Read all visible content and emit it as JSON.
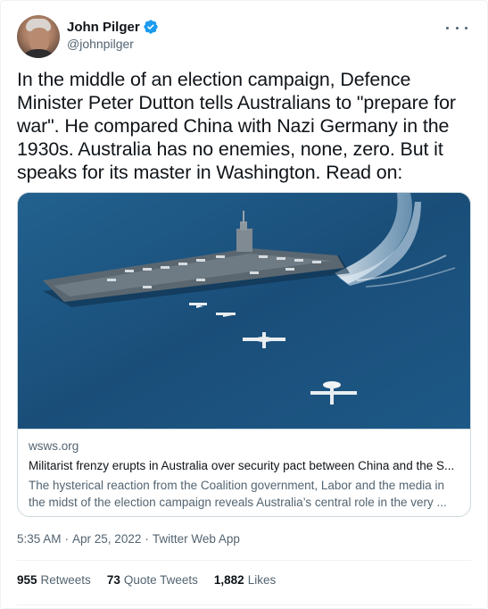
{
  "author": {
    "name": "John Pilger",
    "handle": "@johnpilger"
  },
  "tweet": {
    "text": "In the middle of an election campaign, Defence Minister Peter Dutton tells Australians to \"prepare for war\". He compared China with Nazi Germany in the 1930s. Australia has no enemies, none, zero. But it speaks for its master in Washington. Read on:"
  },
  "link_card": {
    "domain": "wsws.org",
    "title": "Militarist frenzy erupts in Australia over security pact between China and the S...",
    "description_line1": "The hysterical reaction from the Coalition government, Labor and the media in",
    "description_line2": "the midst of the election campaign reveals Australia’s central role in the very ..."
  },
  "meta": {
    "time": "5:35 AM",
    "separator1": "·",
    "date": "Apr 25, 2022",
    "separator2": "·",
    "source": "Twitter Web App"
  },
  "stats": {
    "retweets_count": "955",
    "retweets_label": "Retweets",
    "quotes_count": "73",
    "quotes_label": "Quote Tweets",
    "likes_count": "1,882",
    "likes_label": "Likes"
  },
  "colors": {
    "verified_badge": "#1d9bf0",
    "text_primary": "#0f1419",
    "text_secondary": "#536471"
  },
  "icons": {
    "verified": "verified-badge-icon",
    "more": "more-options-icon"
  }
}
